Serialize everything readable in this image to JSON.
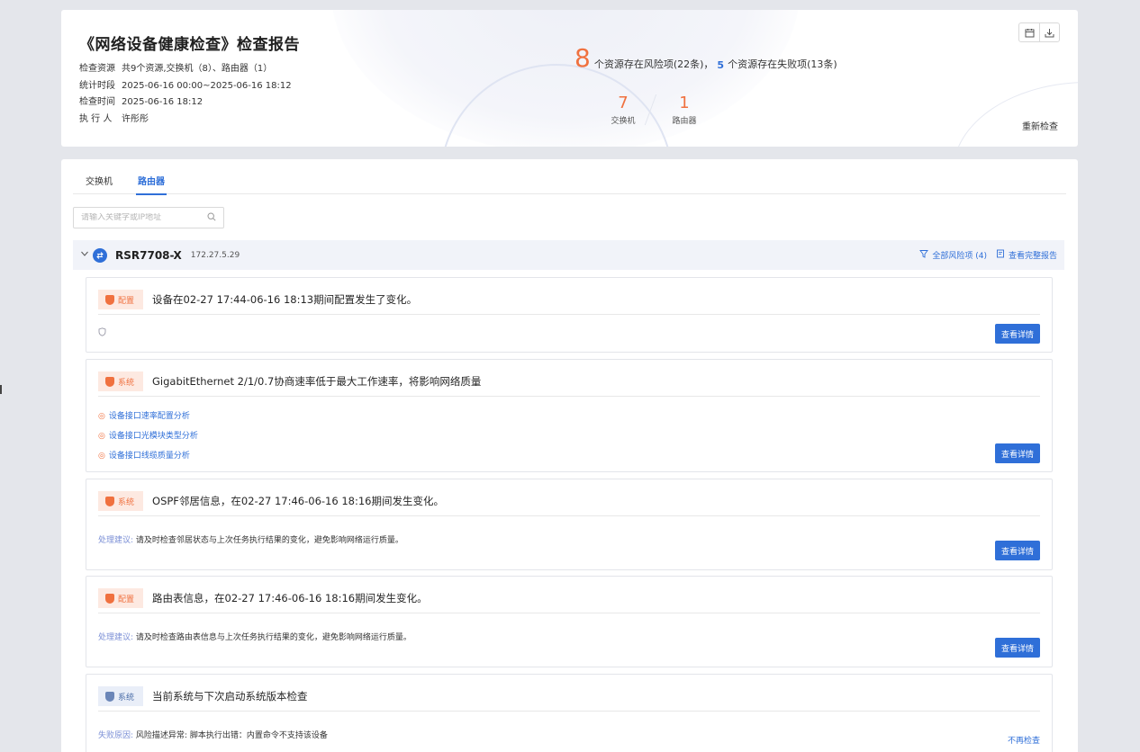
{
  "header": {
    "title": "《网络设备健康检查》检查报告",
    "meta": [
      {
        "key": "检查资源",
        "value": "共9个资源,交换机（8）、路由器（1）"
      },
      {
        "key": "统计时段",
        "value": "2025-06-16 00:00~2025-06-16 18:12"
      },
      {
        "key": "检查时间",
        "value": "2025-06-16 18:12"
      },
      {
        "key": "执 行 人",
        "value": "许彤彤"
      }
    ],
    "risk_count": "8",
    "risk_text": "个资源存在风险项(22条)，",
    "fail_count": "5",
    "fail_text": "个资源存在失败项(13条)",
    "counts": [
      {
        "value": "7",
        "label": "交换机"
      },
      {
        "value": "1",
        "label": "路由器"
      }
    ],
    "recheck_label": "重新检查",
    "icons": [
      "calendar-icon",
      "download-icon"
    ]
  },
  "tabs": [
    {
      "label": "交换机",
      "active": false
    },
    {
      "label": "路由器",
      "active": true
    }
  ],
  "search": {
    "placeholder": "请输入关键字或IP地址"
  },
  "device": {
    "name": "RSR7708-X",
    "ip": "172.27.5.29",
    "filter_label": "全部风险项 (4)",
    "report_label": "查看完整报告"
  },
  "issues": [
    {
      "tag": "配置",
      "tag_color": "#f0713f",
      "title": "设备在02-27 17:44-06-16 18:13期间配置发生了变化。",
      "button": "查看详情"
    },
    {
      "tag": "系统",
      "tag_color": "#f0713f",
      "title": "GigabitEthernet 2/1/0.7协商速率低于最大工作速率，将影响网络质量",
      "links": [
        "设备接口速率配置分析",
        "设备接口光模块类型分析",
        "设备接口线缆质量分析"
      ],
      "button": "查看详情"
    },
    {
      "tag": "系统",
      "tag_color": "#f0713f",
      "title": "OSPF邻居信息，在02-27 17:46-06-16 18:16期间发生变化。",
      "advice_label": "处理建议:",
      "advice": "请及时检查邻居状态与上次任务执行结果的变化，避免影响网络运行质量。",
      "button": "查看详情"
    },
    {
      "tag": "配置",
      "tag_color": "#f0713f",
      "title": "路由表信息，在02-27 17:46-06-16 18:16期间发生变化。",
      "advice_label": "处理建议:",
      "advice": "请及时检查路由表信息与上次任务执行结果的变化，避免影响网络运行质量。",
      "button": "查看详情"
    },
    {
      "tag": "系统",
      "tag_color": "#6b86b8",
      "title": "当前系统与下次启动系统版本检查",
      "advice_label": "失败原因:",
      "advice": "风险描述异常: 脚本执行出错：内置命令不支持该设备",
      "button": "不再检查"
    }
  ]
}
